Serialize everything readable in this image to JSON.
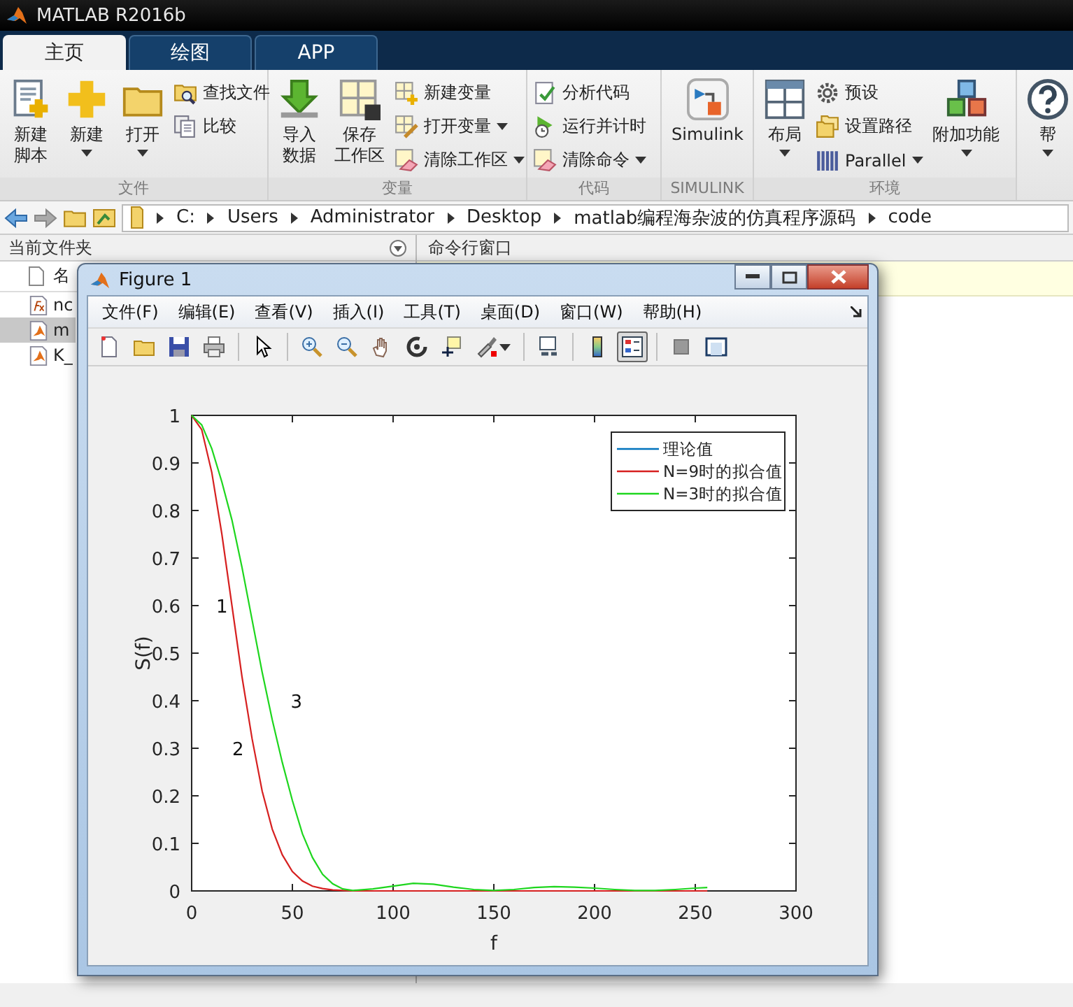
{
  "app_title": "MATLAB R2016b",
  "tabs": [
    {
      "label": "主页",
      "selected": true
    },
    {
      "label": "绘图",
      "selected": false
    },
    {
      "label": "APP",
      "selected": false
    }
  ],
  "ribbon": {
    "groups": [
      {
        "label": "文件",
        "columns": [
          {
            "kind": "large",
            "label": [
              "新建",
              "脚本"
            ],
            "dropdown": false
          },
          {
            "kind": "large",
            "label": [
              "新建"
            ],
            "dropdown": true
          },
          {
            "kind": "large",
            "label": [
              "打开"
            ],
            "dropdown": true
          },
          {
            "kind": "stack",
            "items": [
              {
                "label": "查找文件",
                "dropdown": false
              },
              {
                "label": "比较",
                "dropdown": false
              }
            ]
          }
        ]
      },
      {
        "label": "变量",
        "columns": [
          {
            "kind": "large",
            "label": [
              "导入",
              "数据"
            ],
            "dropdown": false
          },
          {
            "kind": "large",
            "label": [
              "保存",
              "工作区"
            ],
            "dropdown": false
          },
          {
            "kind": "stack",
            "items": [
              {
                "label": "新建变量",
                "dropdown": false
              },
              {
                "label": "打开变量",
                "dropdown": true
              },
              {
                "label": "清除工作区",
                "dropdown": true
              }
            ]
          }
        ]
      },
      {
        "label": "代码",
        "columns": [
          {
            "kind": "stack",
            "items": [
              {
                "label": "分析代码",
                "dropdown": false
              },
              {
                "label": "运行并计时",
                "dropdown": false
              },
              {
                "label": "清除命令",
                "dropdown": true
              }
            ]
          }
        ]
      },
      {
        "label": "SIMULINK",
        "columns": [
          {
            "kind": "large",
            "label": [
              "Simulink"
            ],
            "dropdown": false
          }
        ]
      },
      {
        "label": "环境",
        "columns": [
          {
            "kind": "large",
            "label": [
              "布局"
            ],
            "dropdown": true
          },
          {
            "kind": "stack",
            "items": [
              {
                "label": "预设",
                "dropdown": false
              },
              {
                "label": "设置路径",
                "dropdown": false
              },
              {
                "label": "Parallel",
                "dropdown": true
              }
            ]
          },
          {
            "kind": "large",
            "label": [
              "附加功能"
            ],
            "dropdown": true
          }
        ]
      },
      {
        "columns": [
          {
            "kind": "large",
            "label": [
              "帮"
            ],
            "dropdown": true
          }
        ]
      }
    ]
  },
  "address": {
    "path": [
      "C:",
      "Users",
      "Administrator",
      "Desktop",
      "matlab编程海杂波的仿真程序源码",
      "code"
    ]
  },
  "current_folder": {
    "title": "当前文件夹",
    "column_header": "名",
    "items": [
      {
        "kind": "function",
        "name": "nc",
        "selected": false
      },
      {
        "kind": "script",
        "name": "m",
        "selected": true
      },
      {
        "kind": "script",
        "name": "K_",
        "selected": false
      }
    ]
  },
  "command_window": {
    "title": "命令行窗口"
  },
  "figure": {
    "title": "Figure 1",
    "menu": [
      "文件(F)",
      "编辑(E)",
      "查看(V)",
      "插入(I)",
      "工具(T)",
      "桌面(D)",
      "窗口(W)",
      "帮助(H)"
    ],
    "toolbar": [
      {
        "pressed": false
      },
      {
        "pressed": false
      },
      {
        "pressed": false
      },
      {
        "pressed": false
      },
      {
        "pressed": false
      },
      {
        "pressed": false
      },
      {
        "pressed": false
      },
      {
        "pressed": false
      },
      {
        "pressed": false
      },
      {
        "pressed": false
      },
      {
        "pressed": false
      },
      {
        "pressed": false
      },
      {
        "pressed": false
      },
      {
        "pressed": true
      },
      {
        "pressed": false
      },
      {
        "pressed": false
      }
    ],
    "chart_data": {
      "type": "line",
      "xlabel": "f",
      "ylabel": "S(f)",
      "x": [
        0,
        5,
        10,
        15,
        20,
        25,
        30,
        35,
        40,
        45,
        50,
        55,
        60,
        65,
        70,
        75,
        80,
        90,
        100,
        110,
        120,
        130,
        140,
        150,
        160,
        170,
        180,
        190,
        200,
        210,
        220,
        230,
        240,
        250,
        256
      ],
      "series": [
        {
          "name": "理论值",
          "color": "#0072bd",
          "values": [
            null,
            null,
            null,
            null,
            null,
            null,
            null,
            null,
            null,
            null,
            null,
            null,
            null,
            null,
            null,
            null,
            null,
            null,
            null,
            null,
            null,
            null,
            null,
            null,
            null,
            null,
            null,
            null,
            null,
            null,
            null,
            null,
            null,
            null,
            null
          ]
        },
        {
          "name": "N=9时的拟合值",
          "color": "#d62020",
          "values": [
            1,
            0.97,
            0.88,
            0.75,
            0.6,
            0.45,
            0.32,
            0.21,
            0.13,
            0.076,
            0.041,
            0.021,
            0.01,
            0.005,
            0.002,
            0.001,
            0,
            0,
            0,
            0,
            0,
            0,
            0,
            0,
            0,
            0,
            0,
            0,
            0,
            0,
            0,
            0,
            0,
            0,
            0
          ]
        },
        {
          "name": "N=3时的拟合值",
          "color": "#1ed61e",
          "values": [
            1,
            0.98,
            0.93,
            0.86,
            0.78,
            0.68,
            0.57,
            0.46,
            0.36,
            0.27,
            0.19,
            0.12,
            0.07,
            0.035,
            0.015,
            0.004,
            0.001,
            0.004,
            0.01,
            0.016,
            0.014,
            0.008,
            0.003,
            0.001,
            0.003,
            0.007,
            0.009,
            0.008,
            0.006,
            0.003,
            0.001,
            0.001,
            0.003,
            0.006,
            0.007
          ]
        }
      ],
      "xlim": [
        0,
        300
      ],
      "ylim": [
        0,
        1
      ],
      "xticks": [
        0,
        50,
        100,
        150,
        200,
        250,
        300
      ],
      "yticks": [
        {
          "value": 0,
          "label": "0"
        },
        {
          "value": 0.1,
          "label": "0.1"
        },
        {
          "value": 0.2,
          "label": "0.2"
        },
        {
          "value": 0.3,
          "label": "0.3"
        },
        {
          "value": 0.4,
          "label": "0.4"
        },
        {
          "value": 0.5,
          "label": "0.5"
        },
        {
          "value": 0.6,
          "label": "0.6"
        },
        {
          "value": 0.7,
          "label": "0.7"
        },
        {
          "value": 0.8,
          "label": "0.8"
        },
        {
          "value": 0.9,
          "label": "0.9"
        },
        {
          "value": 1,
          "label": "1"
        }
      ],
      "legend": "upper right",
      "annotations": [
        "1",
        "2",
        "3"
      ]
    }
  }
}
